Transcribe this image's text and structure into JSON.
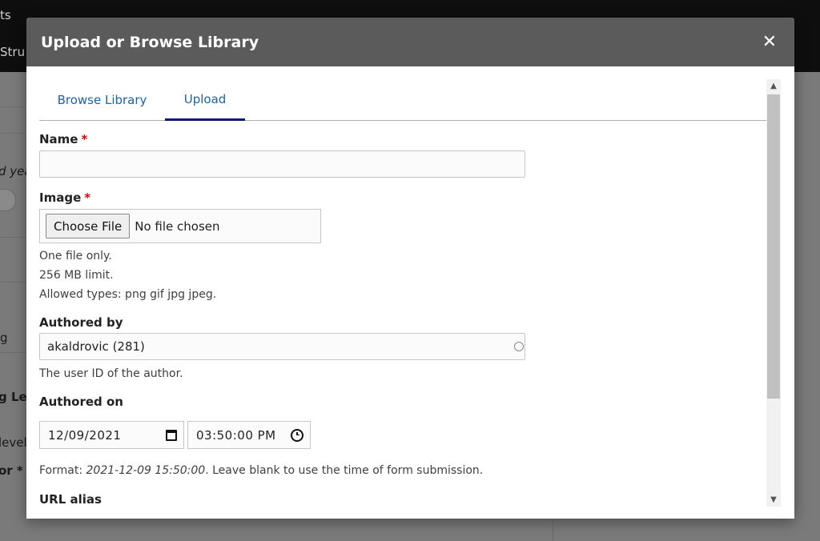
{
  "background": {
    "texts": [
      "ts",
      "Stru",
      "d yea",
      "g",
      "g Leve",
      "level",
      "or *"
    ]
  },
  "dialog": {
    "title": "Upload or Browse Library",
    "close_icon": "✕"
  },
  "tabs": [
    {
      "label": "Browse Library",
      "active": false
    },
    {
      "label": "Upload",
      "active": true
    }
  ],
  "form": {
    "name": {
      "label": "Name",
      "required_marker": "*",
      "value": ""
    },
    "image": {
      "label": "Image",
      "required_marker": "*",
      "button_label": "Choose File",
      "status": "No file chosen",
      "help": [
        "One file only.",
        "256 MB limit.",
        "Allowed types: png gif jpg jpeg."
      ]
    },
    "authored_by": {
      "label": "Authored by",
      "value": "akaldrovic (281)",
      "help": "The user ID of the author."
    },
    "authored_on": {
      "label": "Authored on",
      "date": "12/09/2021",
      "time": "03:50:00 PM",
      "help_prefix": "Format: ",
      "help_example": "2021-12-09 15:50:00",
      "help_suffix": ". Leave blank to use the time of form submission."
    },
    "url_alias": {
      "label": "URL alias"
    }
  },
  "scrollbar": {
    "up_icon": "▲",
    "down_icon": "▼"
  }
}
